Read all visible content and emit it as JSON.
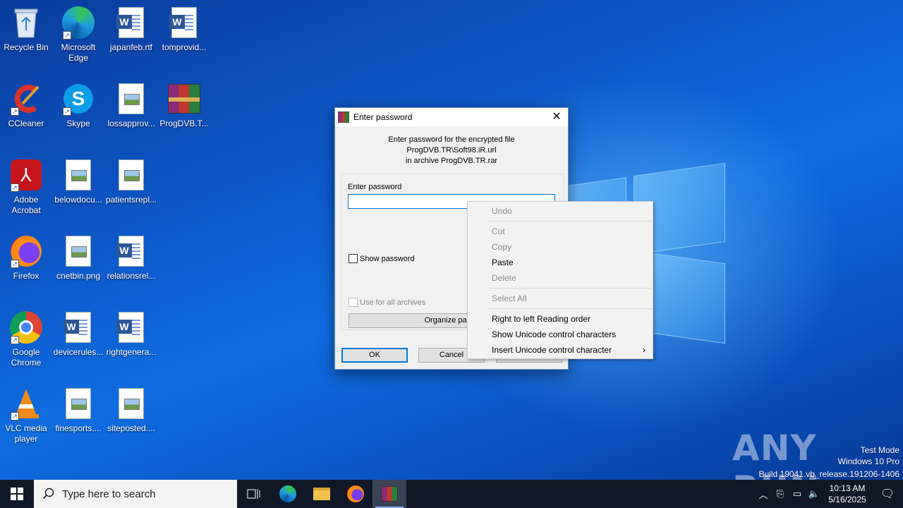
{
  "desktop": {
    "icons": [
      {
        "label": "Recycle Bin"
      },
      {
        "label": "Microsoft Edge"
      },
      {
        "label": "japanfeb.rtf"
      },
      {
        "label": "tomprovid..."
      },
      {
        "label": "CCleaner"
      },
      {
        "label": "Skype"
      },
      {
        "label": "lossapprov..."
      },
      {
        "label": "ProgDVB.T..."
      },
      {
        "label": "Adobe Acrobat"
      },
      {
        "label": "belowdocu..."
      },
      {
        "label": "patientsrepl..."
      },
      {
        "label": "Firefox"
      },
      {
        "label": "cnetbin.png"
      },
      {
        "label": "relationsrel..."
      },
      {
        "label": "Google Chrome"
      },
      {
        "label": "devicerules..."
      },
      {
        "label": "rightgenera..."
      },
      {
        "label": "VLC media player"
      },
      {
        "label": "finesports...."
      },
      {
        "label": "siteposted...."
      }
    ]
  },
  "dialog": {
    "title": "Enter password",
    "close_glyph": "✕",
    "message_line1": "Enter password for the encrypted file",
    "message_line2": "ProgDVB.TR\\Soft98.iR.url",
    "message_line3": "in archive ProgDVB.TR.rar",
    "password_label": "Enter password",
    "password_value": "",
    "show_password_label": "Show password",
    "use_all_label": "Use for all archives",
    "organize_label": "Organize passw",
    "ok_label": "OK",
    "cancel_label": "Cancel"
  },
  "context_menu": {
    "undo": "Undo",
    "cut": "Cut",
    "copy": "Copy",
    "paste": "Paste",
    "delete": "Delete",
    "select_all": "Select All",
    "rtl": "Right to left Reading order",
    "show_unicode": "Show Unicode control characters",
    "insert_unicode": "Insert Unicode control character"
  },
  "watermark": {
    "logo": "ANY RUN",
    "line1": "Test Mode",
    "line2": "Windows 10 Pro",
    "line3": "Build 19041.vb_release.191206-1406"
  },
  "taskbar": {
    "search_placeholder": "Type here to search",
    "time": "10:13 AM",
    "date": "5/16/2025"
  },
  "colors": {
    "accent": "#0078d7",
    "taskbar": "#101828"
  }
}
